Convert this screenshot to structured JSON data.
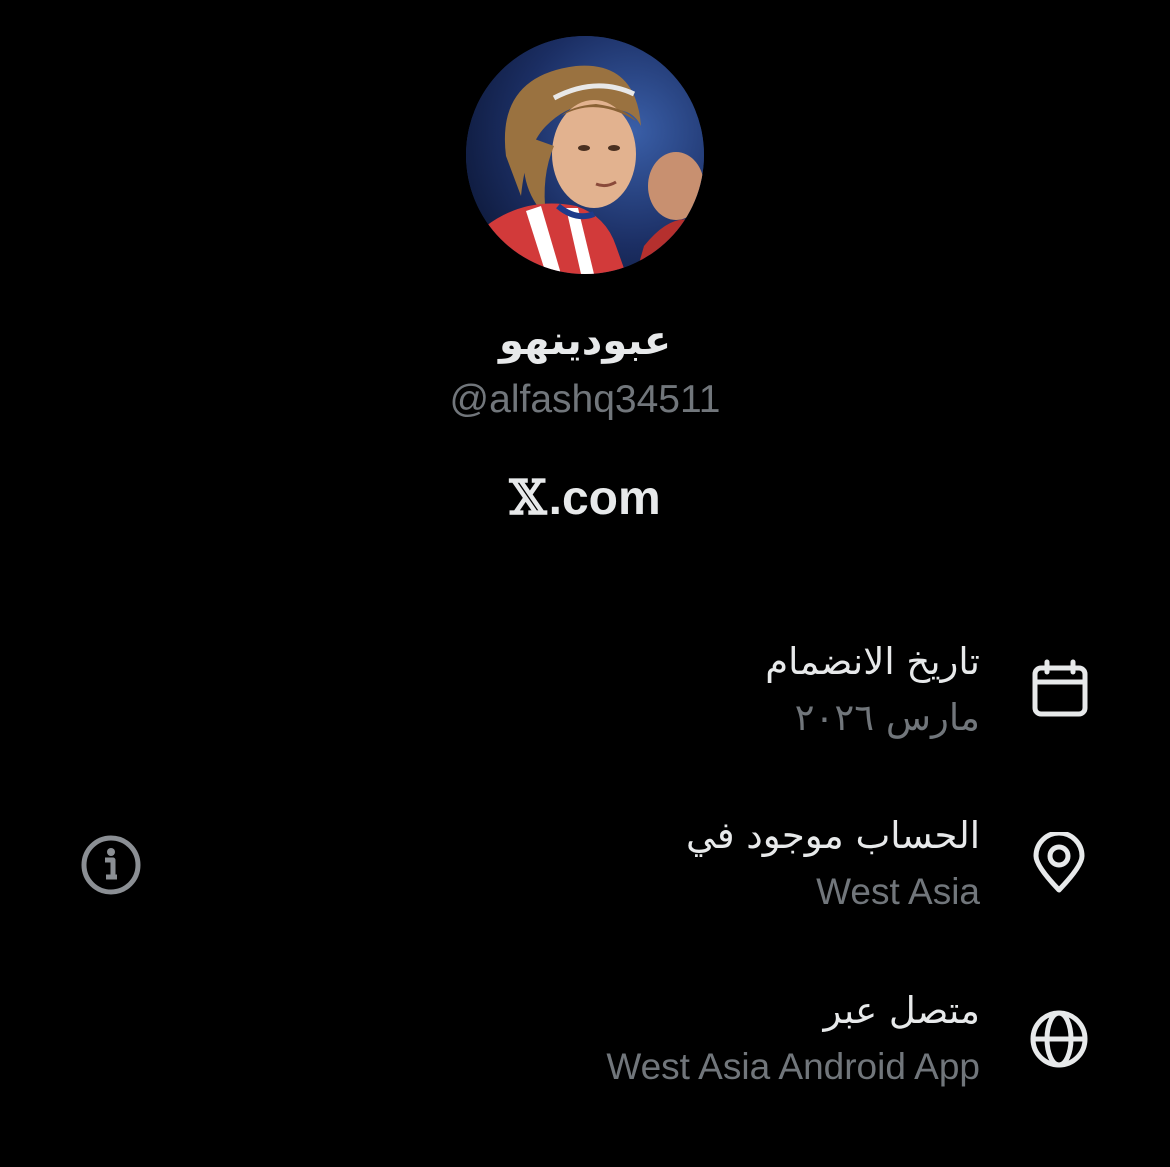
{
  "profile": {
    "display_name": "عبودينهو",
    "handle": "@alfashq34511",
    "brand_mark": "𝕏",
    "brand_suffix": ".com",
    "avatar": "profile-avatar"
  },
  "details": [
    {
      "icon": "calendar-icon",
      "label": "تاريخ الانضمام",
      "value": "مارس ٢٠٢٦"
    },
    {
      "icon": "location-pin-icon",
      "label": "الحساب موجود في",
      "value": "West Asia"
    },
    {
      "icon": "globe-icon",
      "label": "متصل عبر",
      "value": "West Asia Android App"
    }
  ],
  "info_icon": "info-icon",
  "colors": {
    "background": "#000000",
    "primary_text": "#e7e9ea",
    "secondary_text": "#71767b"
  }
}
